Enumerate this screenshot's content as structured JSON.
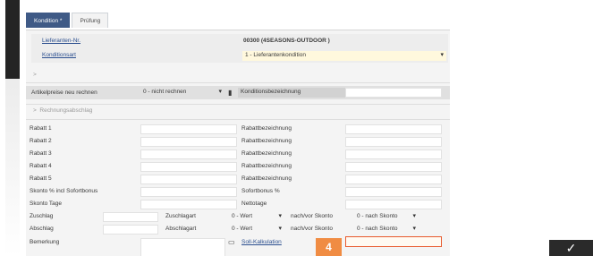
{
  "tabs": [
    {
      "label": "Kondition *",
      "active": true
    },
    {
      "label": "Prüfung",
      "active": false
    }
  ],
  "header": {
    "supplier_label": "Lieferanten-Nr.",
    "supplier_value": "00300 (4SEASONS-OUTDOOR )",
    "condition_type_label": "Konditionsart",
    "condition_type_value": "1 - Lieferantenkondition"
  },
  "section1_title": ">",
  "recalc": {
    "label": "Artikelpreise neu rechnen",
    "value": "0 - nicht rechnen",
    "desc_label": "Konditionsbezeichnung"
  },
  "section2_title": "Rechnungsabschlag",
  "rabatt_rows": [
    {
      "label": "Rabatt 1",
      "desc": "Rabattbezeichnung"
    },
    {
      "label": "Rabatt 2",
      "desc": "Rabattbezeichnung"
    },
    {
      "label": "Rabatt 3",
      "desc": "Rabattbezeichnung"
    },
    {
      "label": "Rabatt 4",
      "desc": "Rabattbezeichnung"
    },
    {
      "label": "Rabatt 5",
      "desc": "Rabattbezeichnung"
    }
  ],
  "skonto": {
    "label": "Skonto % incl Sofortbonus",
    "desc": "Sofortbonus %"
  },
  "skonto_tage": {
    "label": "Skonto Tage",
    "desc": "Nettotage"
  },
  "zuschlag": {
    "label": "Zuschlag",
    "art_label": "Zuschlagart",
    "art_value": "0 - Wert",
    "skonto_label": "nach/vor Skonto",
    "skonto_value": "0 - nach Skonto"
  },
  "abschlag": {
    "label": "Abschlag",
    "art_label": "Abschlagart",
    "art_value": "0 - Wert",
    "skonto_label": "nach/vor Skonto",
    "skonto_value": "0 - nach Skonto"
  },
  "bemerkung": {
    "label": "Bemerkung",
    "link": "Soll-Kalkulation"
  },
  "step_badge": "4",
  "icons": {
    "chevron": "▾",
    "check": "✓",
    "edit": "▭",
    "device": "▮"
  }
}
